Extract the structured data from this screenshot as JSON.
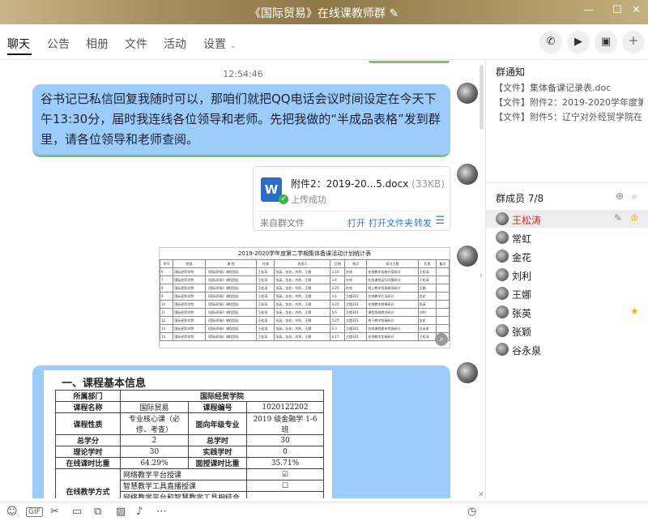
{
  "window": {
    "title": "《国际贸易》在线课教师群",
    "edit_icon": "✎",
    "controls": [
      "—",
      "☐",
      "✕"
    ]
  },
  "tabs": [
    {
      "label": "聊天"
    },
    {
      "label": "公告"
    },
    {
      "label": "相册"
    },
    {
      "label": "文件"
    },
    {
      "label": "活动"
    },
    {
      "label": "设置"
    }
  ],
  "header_actions": [
    "phone-icon",
    "video-icon",
    "screen-share-icon",
    "add-member-icon"
  ],
  "chat": {
    "time": "12:54:46",
    "message_text": "谷书记已私信回复我随时可以，那咱们就把QQ电话会议时间设定在今天下午13:30分，届时我连线各位领导和老师。先把我做的“半成品表格”发到群里，请各位领导和老师查阅。",
    "file": {
      "name": "附件2：2019-20...5.docx",
      "size": "(33KB)",
      "status": "上传成功",
      "source": "来自群文件",
      "open": "打开",
      "open_folder": "打开文件夹",
      "forward": "转发"
    },
    "sheet": {
      "title": "2019-2020学年度第二学期集体备课活动计划统计表",
      "headers": [
        "序号",
        "院部",
        "课 程",
        "任课",
        "参加人",
        "日期",
        "地点",
        "研讨主题",
        "负责",
        "备注"
      ],
      "rows": [
        [
          "6",
          "国际经贸学院",
          "《国际贸易》课程团队",
          "王松涛",
          "张英，金花，刘利，王娜",
          "3.16",
          "在线",
          "在线教学实施方案研讨",
          "王松涛",
          ""
        ],
        [
          "7",
          "国际经贸学院",
          "《国际贸易》课程团队",
          "王松涛",
          "张英，金花，刘利，王娜",
          "3.4",
          "在线",
          "在线课程运行问题研讨",
          "王松涛",
          ""
        ],
        [
          "8",
          "国际经贸学院",
          "《国际贸易》课程团队",
          "王松涛",
          "张英，金花，刘利，王娜",
          "3.25",
          "在线",
          "线上教学资源建设研讨",
          "王娜",
          ""
        ],
        [
          "9",
          "国际经贸学院",
          "《国际贸易》课程团队",
          "王松涛",
          "张英，金花，刘利，王娜",
          "4.1",
          "主楼301",
          "在线教学方法研讨",
          "金花",
          ""
        ],
        [
          "10",
          "国际经贸学院",
          "《国际贸易》课程团队",
          "王松涛",
          "张英，金花，刘利，王娜",
          "4.22",
          "主楼301",
          "在线教学效果研讨",
          "张英",
          ""
        ],
        [
          "11",
          "国际经贸学院",
          "《国际贸易》课程团队",
          "王松涛",
          "张英，金花，刘利，王娜",
          "5.6",
          "主楼301",
          "课程思政教学研讨",
          "刘利",
          ""
        ],
        [
          "12",
          "国际经贸学院",
          "《国际贸易》课程团队",
          "王松涛",
          "张英，金花，刘利，王娜",
          "5.27",
          "主楼301",
          "线下教学衔接研讨",
          "金花",
          ""
        ],
        [
          "13",
          "国际经贸学院",
          "《国际贸易》课程团队",
          "王松涛",
          "张英，金花，刘利，王娜",
          "6.3",
          "主楼301",
          "在线课程期末考核研讨",
          "谷永泉",
          ""
        ],
        [
          "14",
          "国际经贸学院",
          "《国际贸易》课程团队",
          "王松涛",
          "张英，金花，刘利，王娜",
          "6.17",
          "主楼301",
          "在线教学总结研讨",
          "王松涛",
          ""
        ]
      ]
    },
    "doc": {
      "heading": "一、课程基本信息",
      "dept_label": "所属部门",
      "dept_value": "国际经贸学院",
      "course_name_label": "课程名称",
      "course_name_value": "国际贸易",
      "course_no_label": "课程编号",
      "course_no_value": "1020122202",
      "nature_label": "课程性质",
      "nature_value": "专业核心课（必修、考查）",
      "major_label": "面向年级专业",
      "major_value": "2019 级金融学 1-6 班",
      "total_label": "总学分",
      "total_value": "2",
      "hours_label": "总学时",
      "hours_value": "30",
      "theory_label": "理论学时",
      "theory_value": "30",
      "practice_label": "实践学时",
      "practice_value": "0",
      "online_ratio_label": "在线课时比重",
      "online_ratio_value": "64.29%",
      "face_ratio_label": "面授课时比重",
      "face_ratio_value": "35.71%",
      "mode_label": "在线教学方式",
      "modes": [
        {
          "text": "网络教学平台授课",
          "mark": "☑"
        },
        {
          "text": "智慧教学工具直播授课",
          "mark": "☐"
        },
        {
          "text": "网络教学平台和智慧教学工具相结合授课",
          "mark": "☐"
        }
      ]
    }
  },
  "notice": {
    "title": "群通知",
    "items": [
      "【文件】集体备课记录表.doc",
      "【文件】附件2：2019-2020学年度第二...",
      "【文件】附件5：辽宁对外经贸学院在线..."
    ]
  },
  "members": {
    "title": "群成员 7/8",
    "list": [
      {
        "name": "王松涛",
        "role": "owner"
      },
      {
        "name": "常虹"
      },
      {
        "name": "金花"
      },
      {
        "name": "刘利"
      },
      {
        "name": "王娜"
      },
      {
        "name": "张英",
        "role": "admin"
      },
      {
        "name": "张颖"
      },
      {
        "name": "谷永泉"
      }
    ]
  },
  "toolbar": {
    "gif": "GIF"
  },
  "colors": {
    "bubble": "#9ccdfa",
    "accent_link": "#2a7dd1",
    "owner_name": "#e02020"
  }
}
